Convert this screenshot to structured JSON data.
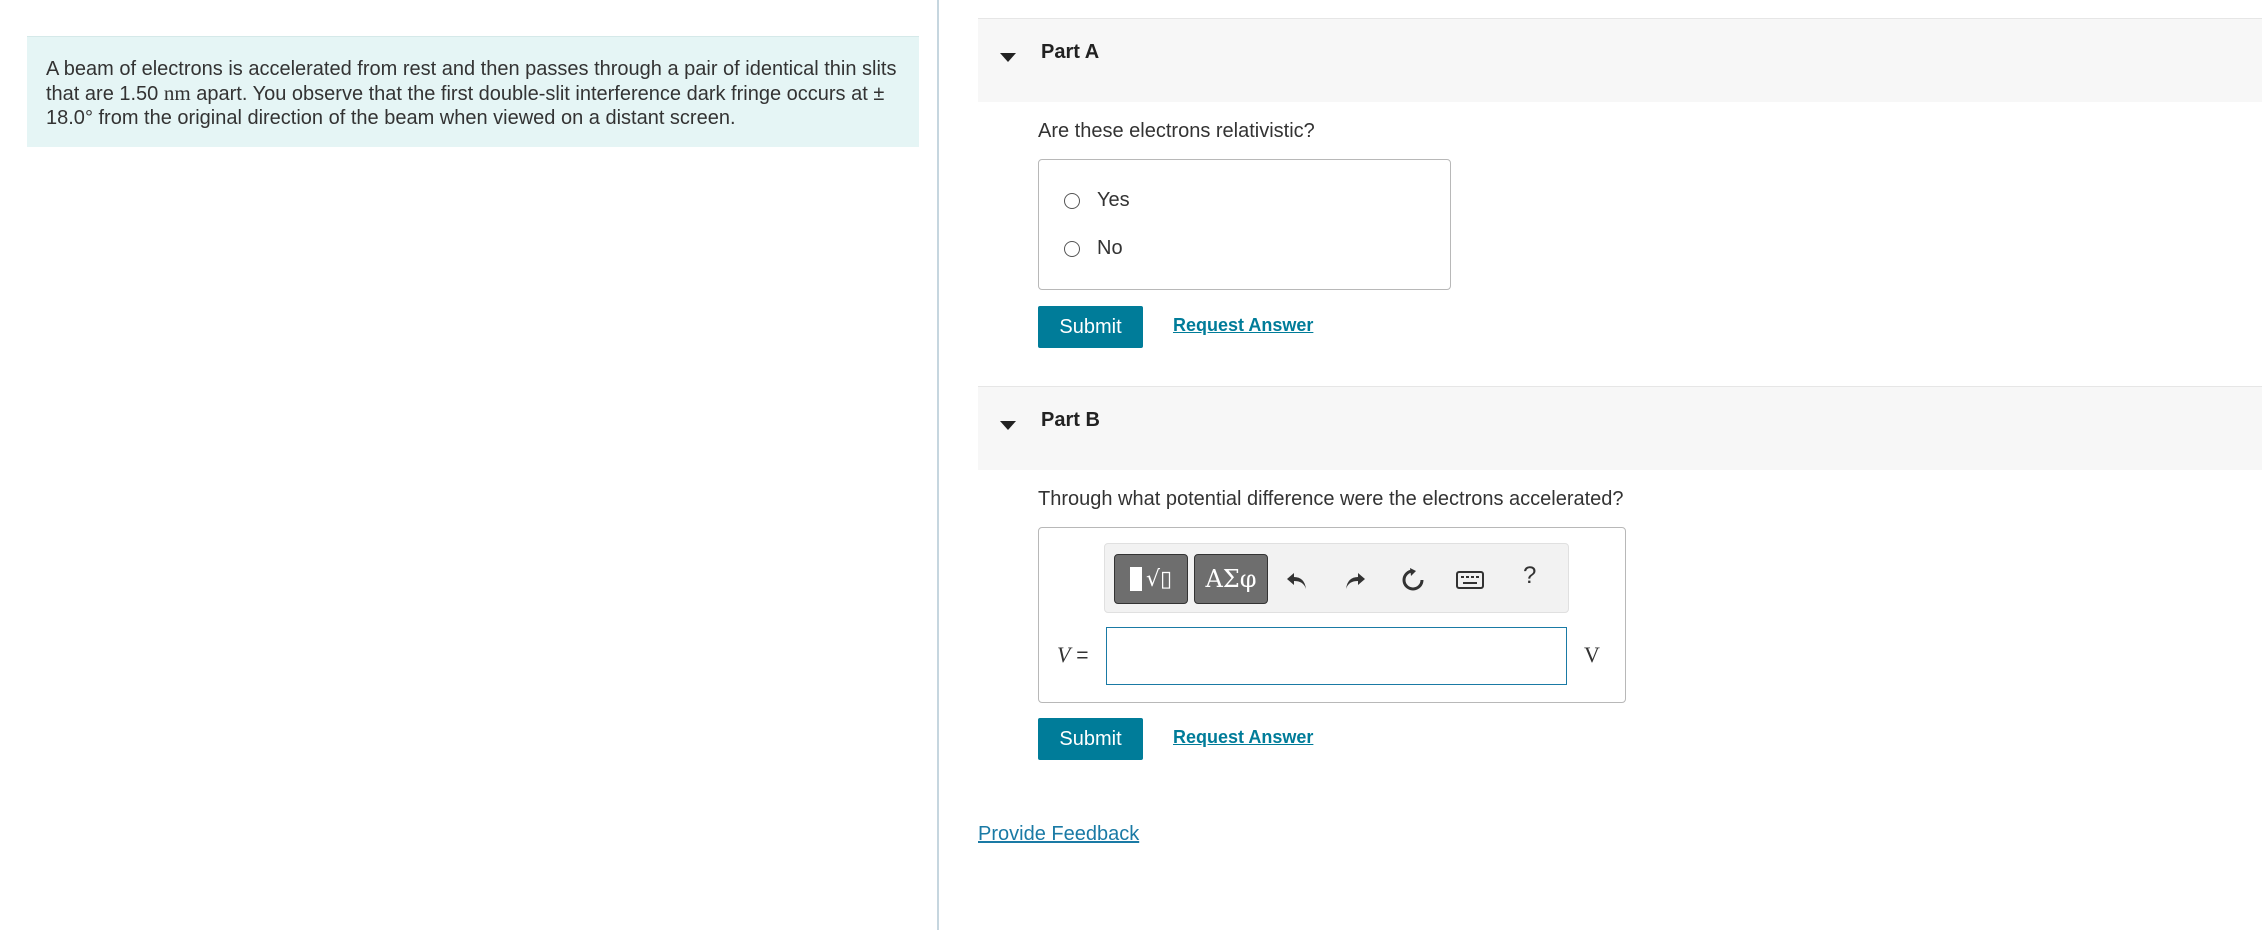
{
  "problem": {
    "text_1": "A beam of electrons is accelerated from rest and then passes through a pair of identical thin slits that are 1.50 ",
    "unit_nm": "nm",
    "text_2": " apart. You observe that the first double-slit interference dark fringe occurs at ± 18.0",
    "degree": "°",
    "text_3": " from the original direction of the beam when viewed on a distant screen."
  },
  "part_a": {
    "title": "Part A",
    "question": "Are these electrons relativistic?",
    "choices": [
      "Yes",
      "No"
    ],
    "submit_label": "Submit",
    "request_label": "Request Answer"
  },
  "part_b": {
    "title": "Part B",
    "question": "Through what potential difference were the electrons accelerated?",
    "toolbar": {
      "template_label": "√▯",
      "greek_label": "ΑΣφ",
      "help_label": "?"
    },
    "variable": "V",
    "equals": "=",
    "input_value": "",
    "unit": "V",
    "submit_label": "Submit",
    "request_label": "Request Answer"
  },
  "feedback_label": "Provide Feedback",
  "colors": {
    "accent": "#007c99",
    "problem_bg": "#e5f5f5",
    "input_border": "#1a7aa5"
  }
}
